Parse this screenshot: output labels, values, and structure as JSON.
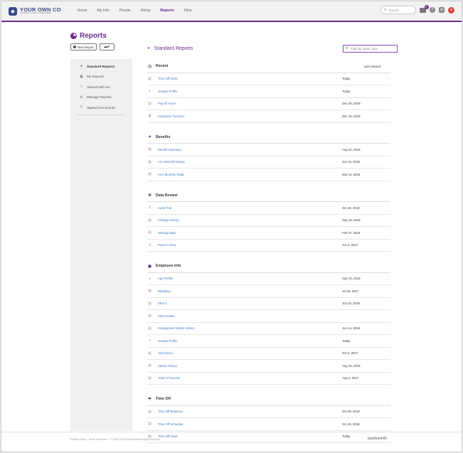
{
  "topbar": {
    "logo_title": "YOUR OWN CO",
    "logo_sub": "COMPANY LOGO GOES HERE",
    "nav": [
      "Home",
      "My Info",
      "People",
      "Hiring",
      "Reports",
      "Files"
    ],
    "active_nav": "Reports",
    "search_placeholder": "Search...",
    "inbox_count": "27"
  },
  "page": {
    "title": "Reports",
    "new_report_label": "New Report"
  },
  "sidebar": {
    "items": [
      {
        "label": "Standard Reports",
        "icon": "pie-chart-icon",
        "active": true
      },
      {
        "label": "My Reports",
        "icon": "folder-user-icon",
        "active": false
      },
      {
        "label": "Shared with me",
        "icon": "people-icon",
        "active": false
      },
      {
        "label": "Manage Reports",
        "icon": "manage-icon",
        "active": false
      },
      {
        "label": "Signed Documents",
        "icon": "signed-doc-icon",
        "active": false
      }
    ]
  },
  "main": {
    "title": "Standard Reports",
    "filter_placeholder": "Filter by name, type",
    "sections": [
      {
        "title": "Recent",
        "right": "Last Viewed",
        "icon": "clock-icon",
        "rows": [
          {
            "name": "Time Off Used",
            "date": "Today",
            "icon": "table-icon"
          },
          {
            "name": "Gender Profile",
            "date": "Today",
            "icon": "pie-icon"
          },
          {
            "name": "Payroll Hours",
            "date": "Dec 20, 2019",
            "icon": "table-icon"
          },
          {
            "name": "Employee Turnover",
            "date": "Dec 16, 2019",
            "icon": "bar-chart-icon"
          }
        ]
      },
      {
        "title": "Benefits",
        "right": "",
        "icon": "heart-hand-icon",
        "rows": [
          {
            "name": "Benefit Summary",
            "date": "Aug 22, 2019",
            "icon": "table-icon"
          },
          {
            "name": "ACA Benefit History",
            "date": "Jun 24, 2019",
            "icon": "table-icon"
          },
          {
            "name": "ACA Monthly Totals",
            "date": "Mar 14, 2018",
            "icon": "table-icon"
          }
        ]
      },
      {
        "title": "Data Review",
        "right": "",
        "icon": "layers-icon",
        "rows": [
          {
            "name": "Audit Trail",
            "date": "Oct 28, 2019",
            "icon": "history-icon"
          },
          {
            "name": "Change History",
            "date": "Sep 16, 2019",
            "icon": "table-icon"
          },
          {
            "name": "Missing Data",
            "date": "Feb 27, 2019",
            "icon": "table-icon"
          },
          {
            "name": "Point-in-Time",
            "date": "Oct 4, 2017",
            "icon": "history-icon"
          }
        ]
      },
      {
        "title": "Employee Info",
        "right": "",
        "icon": "person-circle-icon",
        "rows": [
          {
            "name": "Age Profile",
            "date": "Sep 10, 2019",
            "icon": "pie-icon"
          },
          {
            "name": "Birthdays",
            "date": "Jul 26, 2017",
            "icon": "table-icon"
          },
          {
            "name": "EEO-1",
            "date": "Jun 24, 2019",
            "icon": "table-icon"
          },
          {
            "name": "EEO Details",
            "date": "",
            "icon": "table-icon"
          },
          {
            "name": "Employment Status History",
            "date": "Jun 24, 2019",
            "icon": "table-icon"
          },
          {
            "name": "Gender Profile",
            "date": "Today",
            "icon": "pie-icon"
          },
          {
            "name": "Job History",
            "date": "Oct 4, 2017",
            "icon": "table-icon"
          },
          {
            "name": "Salary History",
            "date": "Aug 16, 2019",
            "icon": "table-icon"
          },
          {
            "name": "Years of Service",
            "date": "Aug 4, 2017",
            "icon": "table-icon"
          }
        ]
      },
      {
        "title": "Time Off",
        "right": "",
        "icon": "time-off-icon",
        "rows": [
          {
            "name": "Time Off Balances",
            "date": "Oct 28, 2019",
            "icon": "table-icon"
          },
          {
            "name": "Time Off Schedule",
            "date": "Oct 28, 2019",
            "icon": "table-icon"
          },
          {
            "name": "Time Off Used",
            "date": "Today",
            "icon": "table-icon"
          }
        ]
      }
    ]
  },
  "footer": {
    "text": "Privacy Policy · Terms of Service · © 2008–2020 BambooHR All rights reserved.",
    "brand": "bambooHR"
  },
  "colors": {
    "accent": "#6a2a8c",
    "link": "#3a7abf"
  }
}
